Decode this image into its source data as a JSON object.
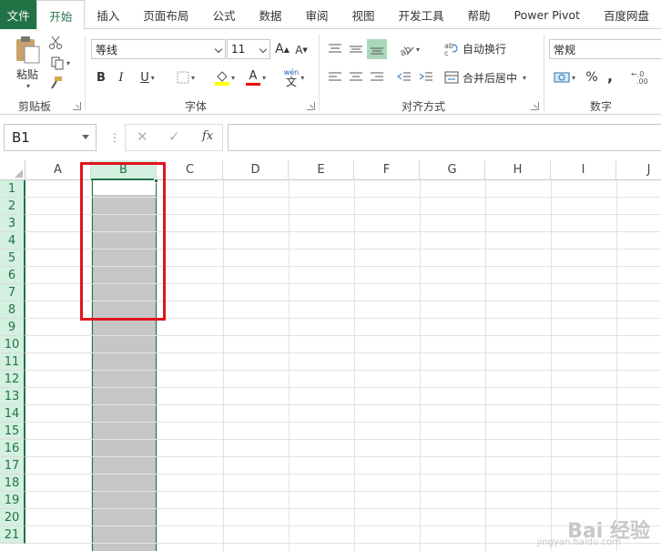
{
  "tabs": [
    "文件",
    "开始",
    "插入",
    "页面布局",
    "公式",
    "数据",
    "审阅",
    "视图",
    "开发工具",
    "帮助",
    "Power Pivot",
    "百度网盘"
  ],
  "ribbon": {
    "clipboard": {
      "paste_label": "粘贴",
      "group_label": "剪贴板"
    },
    "font": {
      "font_name": "等线",
      "font_size": "11",
      "grow_label": "A",
      "shrink_label": "A",
      "bold": "B",
      "italic": "I",
      "underline": "U",
      "font_color_label": "A",
      "wen_label": "wén",
      "wen_char": "文",
      "group_label": "字体"
    },
    "alignment": {
      "wrap_label": "自动换行",
      "merge_label": "合并后居中",
      "group_label": "对齐方式"
    },
    "number": {
      "format": "常规",
      "percent": "%",
      "comma": ",",
      "group_label": "数字"
    }
  },
  "formula_bar": {
    "name_box": "B1",
    "fx_label": "fx"
  },
  "columns": [
    "A",
    "B",
    "C",
    "D",
    "E",
    "F",
    "G",
    "H",
    "I",
    "J"
  ],
  "rows": [
    "1",
    "2",
    "3",
    "4",
    "5",
    "6",
    "7",
    "8",
    "9",
    "10",
    "11",
    "12",
    "13",
    "14",
    "15",
    "16",
    "17",
    "18",
    "19",
    "20",
    "21"
  ],
  "watermark": {
    "brand": "Bai 经验",
    "url": "jingyan.baidu.com"
  },
  "colors": {
    "excel_green": "#217346",
    "selection_gray": "#c6c6c6",
    "highlight_red": "#e0141e"
  }
}
